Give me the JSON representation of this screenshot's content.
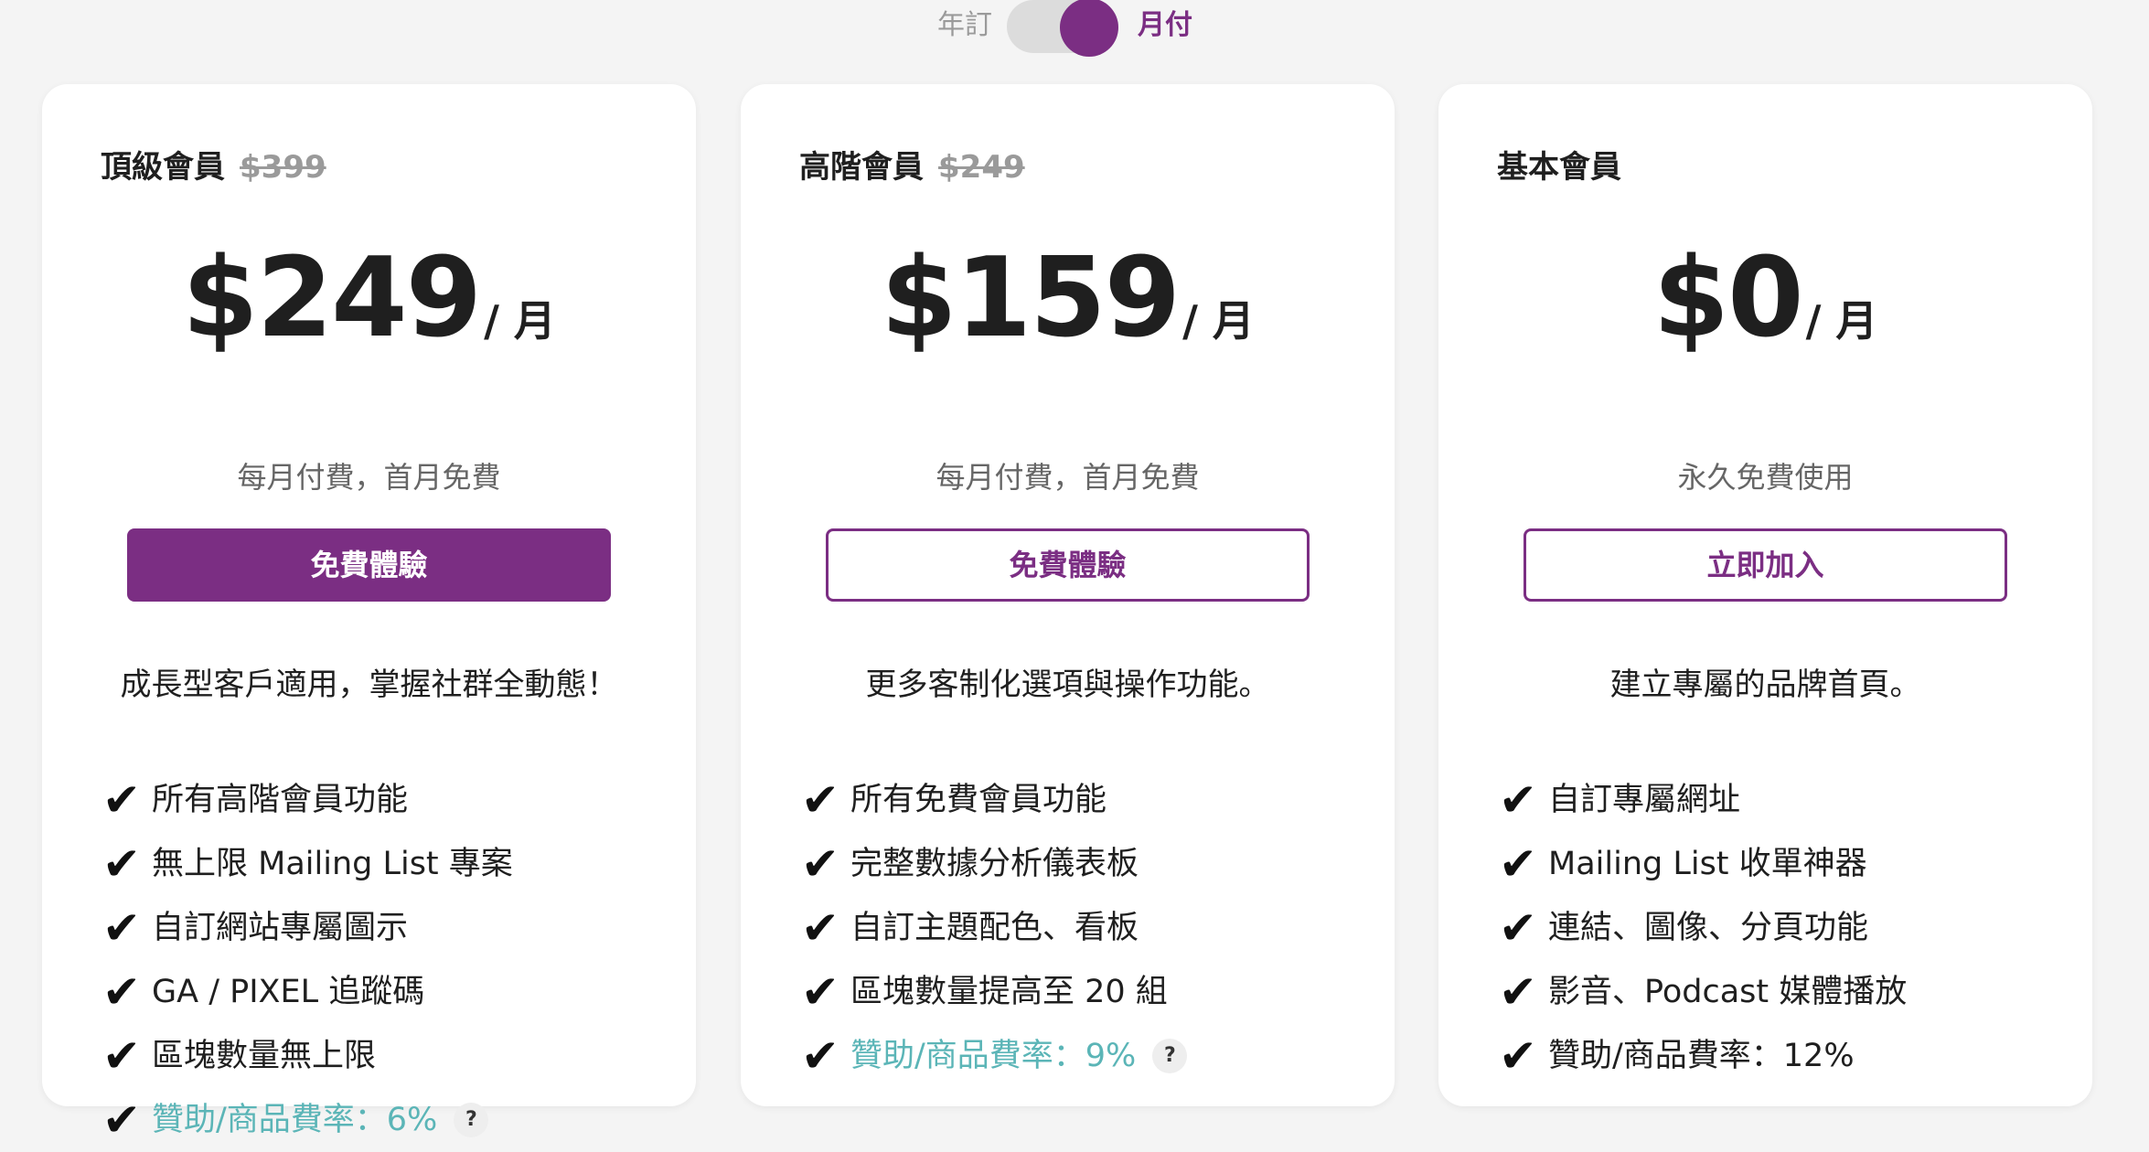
{
  "billing_toggle": {
    "yearly_label": "年訂",
    "monthly_label": "月付",
    "selected": "monthly"
  },
  "colors": {
    "brand_purple": "#7b2e83",
    "highlight_teal": "#5bb5b7",
    "muted_gray": "#9a9a9a",
    "background": "#f4f4f4"
  },
  "plans": [
    {
      "name": "頂級會員",
      "original_price": "$399",
      "price": "$249",
      "unit": "/ 月",
      "price_note": "每月付費，首月免費",
      "cta_label": "免費體驗",
      "cta_style": "filled",
      "description": "成長型客戶適用，掌握社群全動態！",
      "features": [
        {
          "text": "所有高階會員功能"
        },
        {
          "text": "無上限 Mailing List 專案"
        },
        {
          "text": "自訂網站專屬圖示"
        },
        {
          "text": "GA / PIXEL 追蹤碼"
        },
        {
          "text": "區塊數量無上限"
        },
        {
          "text": "贊助/商品費率：6%",
          "highlight": true,
          "help": "?"
        }
      ]
    },
    {
      "name": "高階會員",
      "original_price": "$249",
      "price": "$159",
      "unit": "/ 月",
      "price_note": "每月付費，首月免費",
      "cta_label": "免費體驗",
      "cta_style": "outline",
      "description": "更多客制化選項與操作功能。",
      "features": [
        {
          "text": "所有免費會員功能"
        },
        {
          "text": "完整數據分析儀表板"
        },
        {
          "text": "自訂主題配色、看板"
        },
        {
          "text": "區塊數量提高至 20 組"
        },
        {
          "text": "贊助/商品費率：9%",
          "highlight": true,
          "help": "?"
        }
      ]
    },
    {
      "name": "基本會員",
      "original_price": "",
      "price": "$0",
      "unit": "/ 月",
      "price_note": "永久免費使用",
      "cta_label": "立即加入",
      "cta_style": "outline",
      "description": "建立專屬的品牌首頁。",
      "features": [
        {
          "text": "自訂專屬網址"
        },
        {
          "text": "Mailing List 收單神器"
        },
        {
          "text": "連結、圖像、分頁功能"
        },
        {
          "text": "影音、Podcast 媒體播放"
        },
        {
          "text": "贊助/商品費率：12%"
        }
      ]
    }
  ]
}
